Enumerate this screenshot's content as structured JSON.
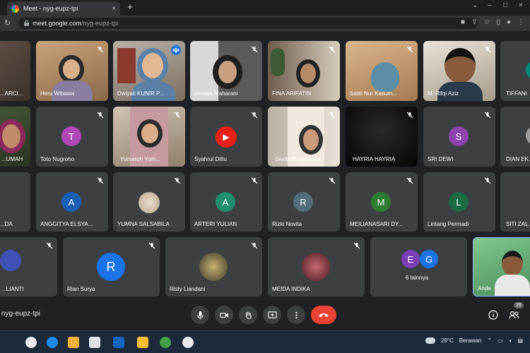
{
  "browser": {
    "tab_title": "Meet - nyg-eupz-tpi",
    "tab_close": "×",
    "new_tab": "+",
    "url_host": "meet.google.com",
    "url_path": "/nyg-eupz-tpi",
    "window_controls": [
      "⌄",
      "–",
      "□",
      "×"
    ]
  },
  "tiles": {
    "r1": [
      "...ARCI...",
      "Heru Wibawa",
      "Dwiyati KUNIR P...",
      "Renata Maharani",
      "FINA ARIFATIN",
      "Satiti Nur Kesum...",
      "M. Rifqi Aziz",
      "TIFFANI"
    ],
    "r2": [
      "...UMAH",
      "Toto Nugroho",
      "Yumaroh Yum...",
      "Syahrul Dittu",
      "Savitri Puspitasari",
      "HAYRIA HAYRIA",
      "SRI DEWI",
      "DIAN EK..."
    ],
    "r3": [
      "...DA",
      "ANGGITYA ELSYA...",
      "YUMNA SALSABILA",
      "ARTERI YULIAN",
      "Rizki Novita",
      "MEILIANASARI DY...",
      "Lintang Permadi",
      "SITI ZAL..."
    ],
    "r4": [
      "...LIANTI",
      "Rian Surya",
      "Risty Liandani",
      "MEIDA INDIKA",
      "6 lainnya",
      "Anda"
    ]
  },
  "avatars": {
    "toto": "T",
    "syahrul": "▶",
    "sri": "S",
    "anggitya": "A",
    "arteri": "A",
    "rizki": "R",
    "meilianasari": "M",
    "lintang": "L",
    "rian": "R",
    "others_e": "E",
    "others_g": "G"
  },
  "colors": {
    "toto": "#b048b5",
    "syahrul": "#e62117",
    "sri": "#8e44ad",
    "anggitya": "#1a5fb4",
    "arteri": "#1e8e6e",
    "rizki": "#546e7a",
    "meilianasari": "#2e7d32",
    "lintang": "#1b6b45",
    "rian": "#1a73e8",
    "others_e": "#7b3fb8",
    "others_g": "#1a73e8",
    "end_call": "#ea4335",
    "speaking": "#1a73e8"
  },
  "meeting_code": "nyg-eupz-tpi",
  "people_count": "26",
  "taskbar": {
    "temperature": "28°C",
    "weather": "Berawan"
  }
}
